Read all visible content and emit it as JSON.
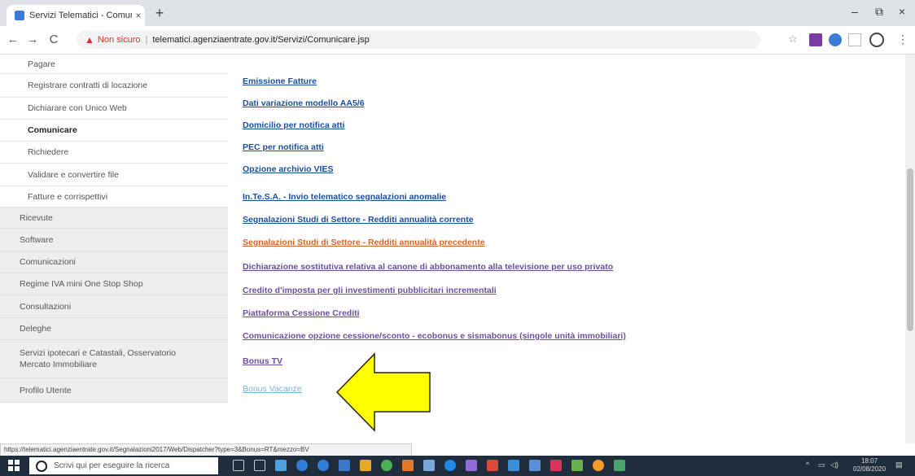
{
  "browser": {
    "tab_title": "Servizi Telematici - Comunicare",
    "tab_close": "×",
    "new_tab": "+",
    "minimize": "–",
    "restore": "⧉",
    "close": "×",
    "back": "←",
    "forward": "→",
    "reload": "C",
    "not_secure": "Non sicuro",
    "url": "telematici.agenziaentrate.gov.it/Servizi/Comunicare.jsp",
    "status_url": "https://telematici.agenziaentrate.gov.it/Segnalazioni2017/Web/Dispatcher?type=3&Bonus=RT&mezzo=BV"
  },
  "sidebar": {
    "items": [
      {
        "label": "Pagare",
        "level": "sub"
      },
      {
        "label": "Registrare contratti di locazione",
        "level": "sub"
      },
      {
        "label": "Dichiarare con Unico Web",
        "level": "sub"
      },
      {
        "label": "Comunicare",
        "level": "sub",
        "active": true
      },
      {
        "label": "Richiedere",
        "level": "sub"
      },
      {
        "label": "Validare e convertire file",
        "level": "sub"
      },
      {
        "label": "Fatture e corrispettivi",
        "level": "sub"
      },
      {
        "label": "Ricevute",
        "level": "top"
      },
      {
        "label": "Software",
        "level": "top"
      },
      {
        "label": "Comunicazioni",
        "level": "top"
      },
      {
        "label": "Regime IVA mini One Stop Shop",
        "level": "top"
      },
      {
        "label": "Consultazioni",
        "level": "top"
      },
      {
        "label": "Deleghe",
        "level": "top"
      },
      {
        "label": "Servizi ipotecari e Catastali, Osservatorio Mercato Immobiliare",
        "level": "top"
      },
      {
        "label": "Profilo Utente",
        "level": "top"
      }
    ]
  },
  "main": {
    "links": [
      {
        "label": "Emissione Fatture",
        "state": "normal"
      },
      {
        "label": "Dati variazione modello AA5/6",
        "state": "normal"
      },
      {
        "label": "Domicilio per notifica atti",
        "state": "normal"
      },
      {
        "label": "PEC per notifica atti",
        "state": "normal"
      },
      {
        "label": "Opzione archivio VIES",
        "state": "normal"
      },
      {
        "label": "In.Te.S.A. - Invio telematico segnalazioni anomalie",
        "state": "normal"
      },
      {
        "label": "Segnalazioni Studi di Settore - Redditi annualità corrente",
        "state": "normal"
      },
      {
        "label": "Segnalazioni Studi di Settore - Redditi annualità precedente",
        "state": "hover"
      },
      {
        "label": "Dichiarazione sostitutiva relativa al canone di abbonamento alla televisione per uso privato",
        "state": "visited"
      },
      {
        "label": "Credito d'imposta per gli investimenti pubblicitari incrementali",
        "state": "visited"
      },
      {
        "label": "Piattaforma Cessione Crediti",
        "state": "visited"
      },
      {
        "label": "Comunicazione opzione cessione/sconto - ecobonus e sismabonus (singole unità immobiliari)",
        "state": "visited"
      },
      {
        "label": "Bonus TV",
        "state": "visited"
      },
      {
        "label": "Bonus Vacanze",
        "state": "light"
      }
    ]
  },
  "taskbar": {
    "search_placeholder": "Scrivi qui per eseguire la ricerca",
    "time": "18:07",
    "date": "02/08/2020"
  },
  "colors": {
    "link": "#1a4e9e",
    "visited": "#6a4fa3",
    "hover": "#d8632a",
    "arrow_fill": "#ffff00",
    "taskbar": "#1f2d3d"
  }
}
